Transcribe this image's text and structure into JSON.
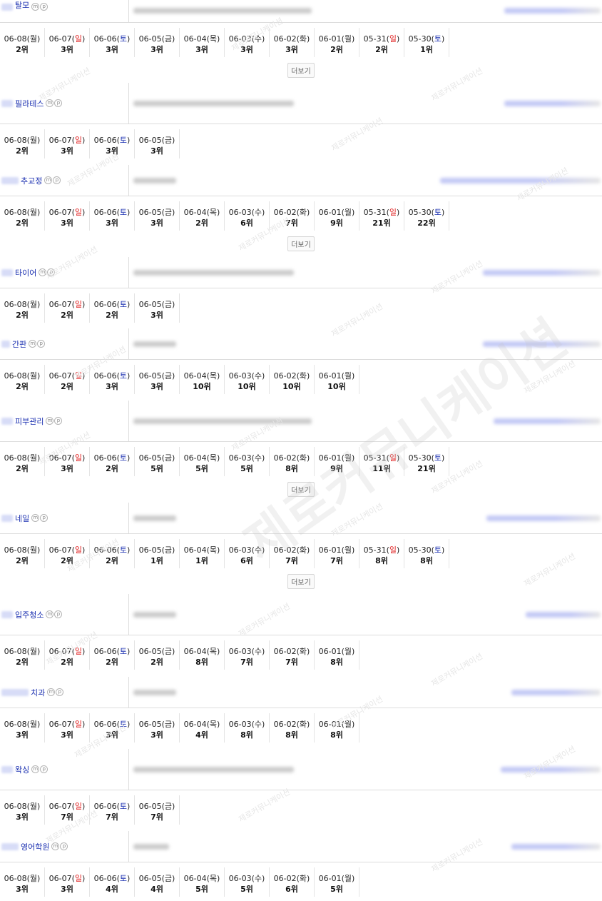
{
  "watermark": "제로커뮤니케이션",
  "more_label": "더보기",
  "mobile_badge": "m",
  "pc_badge": "p",
  "sections": [
    {
      "keyword": "탈모",
      "head_h": 32,
      "blur_w": 16,
      "url_w": 250,
      "right_w": 135,
      "more": true,
      "days": [
        [
          "06-08(",
          "월",
          ")",
          "2위"
        ],
        [
          "06-07(",
          "일",
          ")",
          "3위"
        ],
        [
          "06-06(",
          "토",
          ")",
          "3위"
        ],
        [
          "06-05(",
          "금",
          ")",
          "3위"
        ],
        [
          "06-04(",
          "목",
          ")",
          "3위"
        ],
        [
          "06-03(",
          "수",
          ")",
          "3위"
        ],
        [
          "06-02(",
          "화",
          ")",
          "3위"
        ],
        [
          "06-01(",
          "월",
          ")",
          "2위"
        ],
        [
          "05-31(",
          "일",
          ")",
          "2위"
        ],
        [
          "05-30(",
          "토",
          ")",
          "1위"
        ]
      ]
    },
    {
      "keyword": "필라테스",
      "head_h": 58,
      "blur_w": 16,
      "url_w": 225,
      "right_w": 135,
      "more": false,
      "days": [
        [
          "06-08(",
          "월",
          ")",
          "2위"
        ],
        [
          "06-07(",
          "일",
          ")",
          "3위"
        ],
        [
          "06-06(",
          "토",
          ")",
          "3위"
        ],
        [
          "06-05(",
          "금",
          ")",
          "3위"
        ]
      ]
    },
    {
      "keyword": "추교정",
      "head_h": 44,
      "blur_w": 24,
      "url_w": 60,
      "right_w": 225,
      "more": true,
      "days": [
        [
          "06-08(",
          "월",
          ")",
          "2위"
        ],
        [
          "06-07(",
          "일",
          ")",
          "3위"
        ],
        [
          "06-06(",
          "토",
          ")",
          "3위"
        ],
        [
          "06-05(",
          "금",
          ")",
          "3위"
        ],
        [
          "06-04(",
          "목",
          ")",
          "2위"
        ],
        [
          "06-03(",
          "수",
          ")",
          "6위"
        ],
        [
          "06-02(",
          "화",
          ")",
          "7위"
        ],
        [
          "06-01(",
          "월",
          ")",
          "9위"
        ],
        [
          "05-31(",
          "일",
          ")",
          "21위"
        ],
        [
          "05-30(",
          "토",
          ")",
          "22위"
        ]
      ]
    },
    {
      "keyword": "타이어",
      "head_h": 44,
      "blur_w": 16,
      "url_w": 225,
      "right_w": 165,
      "more": false,
      "days": [
        [
          "06-08(",
          "월",
          ")",
          "2위"
        ],
        [
          "06-07(",
          "일",
          ")",
          "2위"
        ],
        [
          "06-06(",
          "토",
          ")",
          "2위"
        ],
        [
          "06-05(",
          "금",
          ")",
          "3위"
        ]
      ]
    },
    {
      "keyword": "간판",
      "head_h": 44,
      "blur_w": 12,
      "url_w": 60,
      "right_w": 165,
      "more": false,
      "days": [
        [
          "06-08(",
          "월",
          ")",
          "2위"
        ],
        [
          "06-07(",
          "일",
          ")",
          "2위"
        ],
        [
          "06-06(",
          "토",
          ")",
          "3위"
        ],
        [
          "06-05(",
          "금",
          ")",
          "3위"
        ],
        [
          "06-04(",
          "목",
          ")",
          "10위"
        ],
        [
          "06-03(",
          "수",
          ")",
          "10위"
        ],
        [
          "06-02(",
          "화",
          ")",
          "10위"
        ],
        [
          "06-01(",
          "월",
          ")",
          "10위"
        ]
      ]
    },
    {
      "keyword": "피부관리",
      "head_h": 58,
      "blur_w": 16,
      "url_w": 250,
      "right_w": 150,
      "more": true,
      "days": [
        [
          "06-08(",
          "월",
          ")",
          "2위"
        ],
        [
          "06-07(",
          "일",
          ")",
          "3위"
        ],
        [
          "06-06(",
          "토",
          ")",
          "2위"
        ],
        [
          "06-05(",
          "금",
          ")",
          "5위"
        ],
        [
          "06-04(",
          "목",
          ")",
          "5위"
        ],
        [
          "06-03(",
          "수",
          ")",
          "5위"
        ],
        [
          "06-02(",
          "화",
          ")",
          "8위"
        ],
        [
          "06-01(",
          "월",
          ")",
          "9위"
        ],
        [
          "05-31(",
          "일",
          ")",
          "11위"
        ],
        [
          "05-30(",
          "토",
          ")",
          "21위"
        ]
      ]
    },
    {
      "keyword": "네일",
      "head_h": 44,
      "blur_w": 16,
      "url_w": 60,
      "right_w": 160,
      "more": true,
      "days": [
        [
          "06-08(",
          "월",
          ")",
          "2위"
        ],
        [
          "06-07(",
          "일",
          ")",
          "2위"
        ],
        [
          "06-06(",
          "토",
          ")",
          "2위"
        ],
        [
          "06-05(",
          "금",
          ")",
          "1위"
        ],
        [
          "06-04(",
          "목",
          ")",
          "1위"
        ],
        [
          "06-03(",
          "수",
          ")",
          "6위"
        ],
        [
          "06-02(",
          "화",
          ")",
          "7위"
        ],
        [
          "06-01(",
          "월",
          ")",
          "7위"
        ],
        [
          "05-31(",
          "일",
          ")",
          "8위"
        ],
        [
          "05-30(",
          "토",
          ")",
          "8위"
        ]
      ]
    },
    {
      "keyword": "입주청소",
      "head_h": 58,
      "blur_w": 16,
      "url_w": 60,
      "right_w": 105,
      "more": false,
      "days": [
        [
          "06-08(",
          "월",
          ")",
          "2위"
        ],
        [
          "06-07(",
          "일",
          ")",
          "2위"
        ],
        [
          "06-06(",
          "토",
          ")",
          "2위"
        ],
        [
          "06-05(",
          "금",
          ")",
          "2위"
        ],
        [
          "06-04(",
          "목",
          ")",
          "8위"
        ],
        [
          "06-03(",
          "수",
          ")",
          "7위"
        ],
        [
          "06-02(",
          "화",
          ")",
          "7위"
        ],
        [
          "06-01(",
          "월",
          ")",
          "8위"
        ]
      ]
    },
    {
      "keyword": "치과",
      "head_h": 44,
      "blur_w": 38,
      "url_w": 60,
      "right_w": 125,
      "more": false,
      "days": [
        [
          "06-08(",
          "월",
          ")",
          "3위"
        ],
        [
          "06-07(",
          "일",
          ")",
          "3위"
        ],
        [
          "06-06(",
          "토",
          ")",
          "3위"
        ],
        [
          "06-05(",
          "금",
          ")",
          "3위"
        ],
        [
          "06-04(",
          "목",
          ")",
          "4위"
        ],
        [
          "06-03(",
          "수",
          ")",
          "8위"
        ],
        [
          "06-02(",
          "화",
          ")",
          "8위"
        ],
        [
          "06-01(",
          "월",
          ")",
          "8위"
        ]
      ]
    },
    {
      "keyword": "왁싱",
      "head_h": 58,
      "blur_w": 16,
      "url_w": 225,
      "right_w": 140,
      "more": false,
      "days": [
        [
          "06-08(",
          "월",
          ")",
          "3위"
        ],
        [
          "06-07(",
          "일",
          ")",
          "7위"
        ],
        [
          "06-06(",
          "토",
          ")",
          "7위"
        ],
        [
          "06-05(",
          "금",
          ")",
          "7위"
        ]
      ]
    },
    {
      "keyword": "영어학원",
      "head_h": 44,
      "blur_w": 24,
      "url_w": 50,
      "right_w": 125,
      "more": false,
      "days": [
        [
          "06-08(",
          "월",
          ")",
          "3위"
        ],
        [
          "06-07(",
          "일",
          ")",
          "3위"
        ],
        [
          "06-06(",
          "토",
          ")",
          "4위"
        ],
        [
          "06-05(",
          "금",
          ")",
          "4위"
        ],
        [
          "06-04(",
          "목",
          ")",
          "5위"
        ],
        [
          "06-03(",
          "수",
          ")",
          "5위"
        ],
        [
          "06-02(",
          "화",
          ")",
          "6위"
        ],
        [
          "06-01(",
          "월",
          ")",
          "5위"
        ]
      ]
    }
  ]
}
